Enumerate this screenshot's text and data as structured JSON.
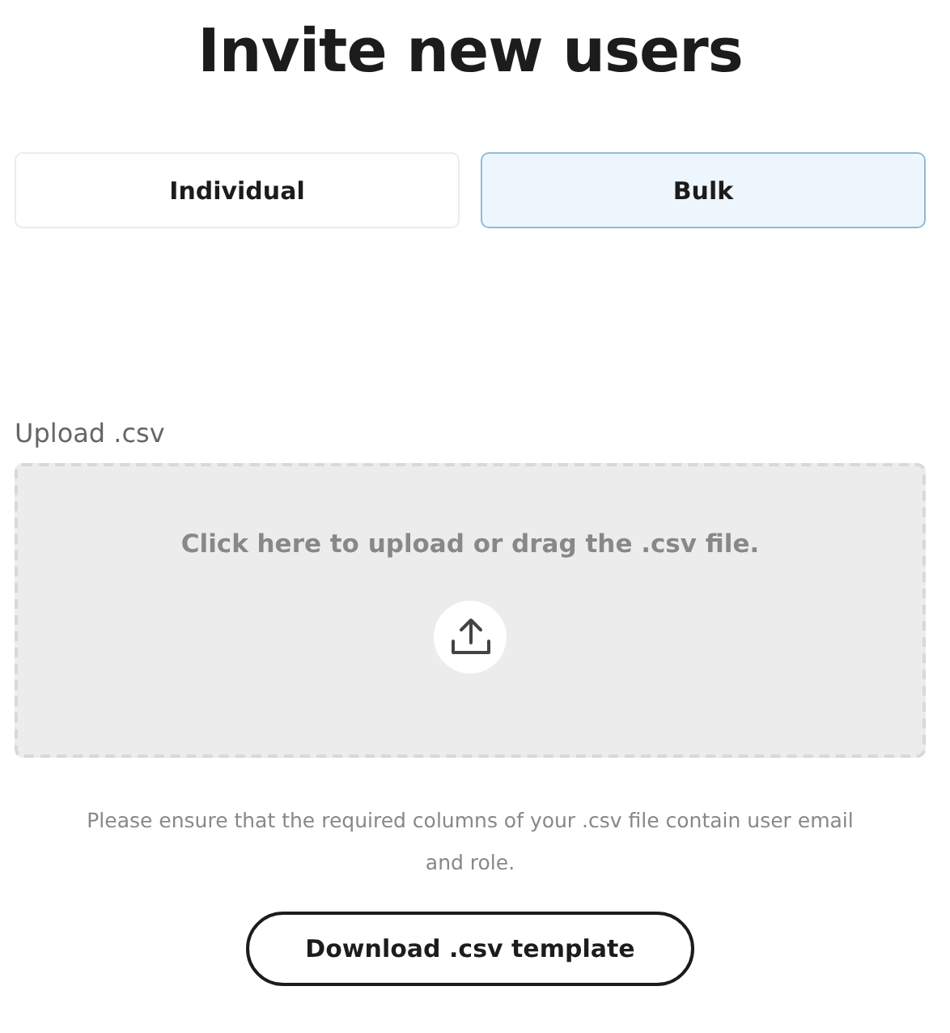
{
  "title": "Invite new users",
  "tabs": [
    {
      "label": "Individual",
      "selected": false
    },
    {
      "label": "Bulk",
      "selected": true
    }
  ],
  "upload": {
    "label": "Upload .csv",
    "prompt": "Click here to upload or drag the .csv file."
  },
  "note": "Please ensure that the required columns of your .csv file contain user email and role.",
  "download_button": "Download .csv template"
}
